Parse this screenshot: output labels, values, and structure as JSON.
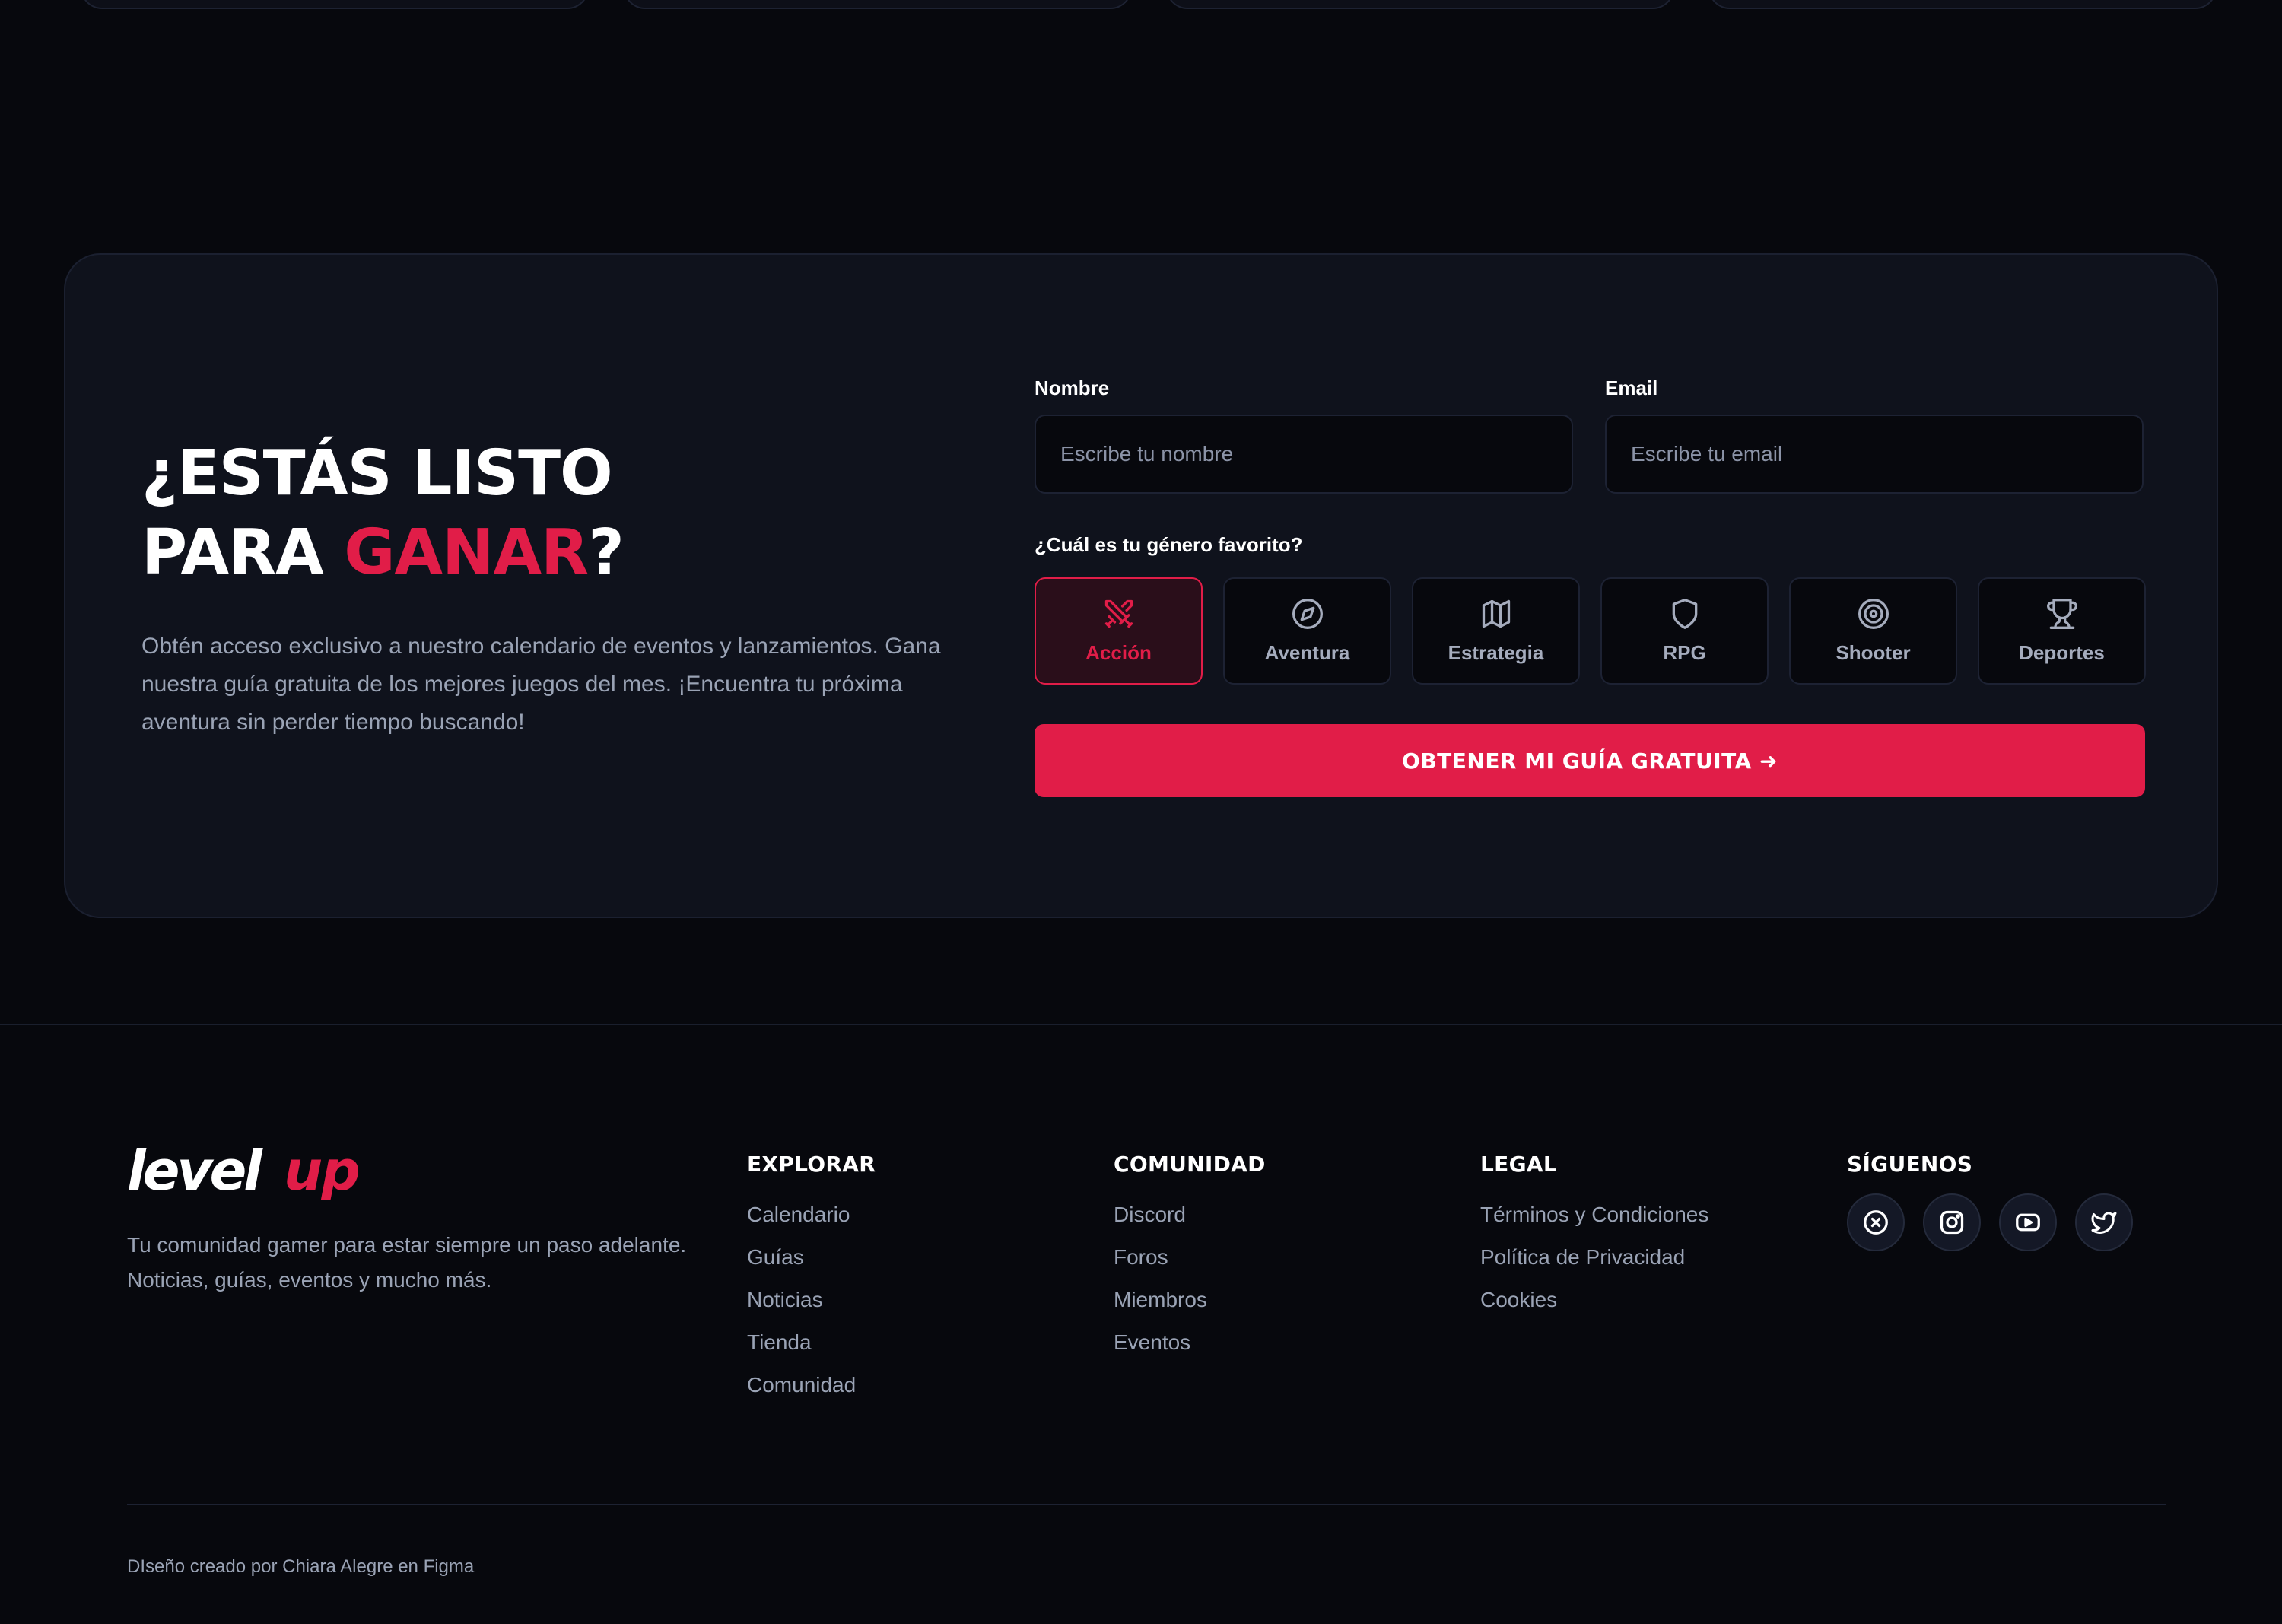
{
  "cta": {
    "title_line1": "¿ESTÁS LISTO",
    "title_line2_prefix": "PARA ",
    "title_line2_accent": "GANAR",
    "title_line2_suffix": "?",
    "description": "Obtén acceso exclusivo a nuestro calendario de eventos y lanzamientos. Gana nuestra guía gratuita de los mejores juegos del mes. ¡Encuentra tu próxima aventura sin perder tiempo buscando!",
    "name_label": "Nombre",
    "name_placeholder": "Escribe tu nombre",
    "email_label": "Email",
    "email_placeholder": "Escribe tu email",
    "genre_question": "¿Cuál es tu género favorito?",
    "genres": [
      {
        "label": "Acción",
        "icon": "crossed-swords-icon",
        "selected": true
      },
      {
        "label": "Aventura",
        "icon": "compass-icon",
        "selected": false
      },
      {
        "label": "Estrategia",
        "icon": "map-icon",
        "selected": false
      },
      {
        "label": "RPG",
        "icon": "shield-icon",
        "selected": false
      },
      {
        "label": "Shooter",
        "icon": "target-icon",
        "selected": false
      },
      {
        "label": "Deportes",
        "icon": "trophy-icon",
        "selected": false
      }
    ],
    "submit_label": "OBTENER MI GUÍA GRATUITA ➜"
  },
  "footer": {
    "logo_text_white": "level",
    "logo_text_red": "up",
    "tagline": "Tu comunidad gamer para estar siempre un paso adelante. Noticias, guías, eventos y mucho más.",
    "columns": [
      {
        "title": "EXPLORAR",
        "links": [
          "Calendario",
          "Guías",
          "Noticias",
          "Tienda",
          "Comunidad"
        ]
      },
      {
        "title": "COMUNIDAD",
        "links": [
          "Discord",
          "Foros",
          "Miembros",
          "Eventos"
        ]
      },
      {
        "title": "LEGAL",
        "links": [
          "Términos y Condiciones",
          "Política de Privacidad",
          "Cookies"
        ]
      }
    ],
    "social_title": "SÍGUENOS",
    "social_icons": [
      "x-icon",
      "instagram-icon",
      "youtube-icon",
      "twitter-icon"
    ],
    "credit": "DIseño creado por Chiara Alegre en Figma"
  },
  "colors": {
    "background": "#07080d",
    "panel": "#0f121c",
    "accent": "#e11d48",
    "muted_text": "#9aa3b5"
  }
}
